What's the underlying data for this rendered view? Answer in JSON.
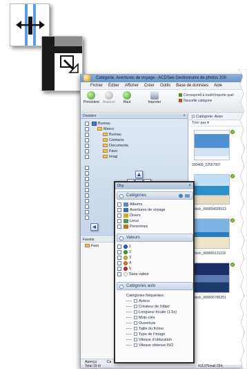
{
  "app": {
    "title": "Catégorie: Aventures de voyage - ACDSee Gestionnaire de photos 200",
    "menu": [
      "Fichier",
      "Éditer",
      "Afficher",
      "Créer",
      "Outils",
      "Base de données",
      "Aide"
    ],
    "toolbar": {
      "previous": "Précédent",
      "forward": "Avancer",
      "up": "Haut",
      "import": "Importer",
      "match_any": "Correspond à tout/n'importe quel",
      "new_category": "Nouvelle catégorie"
    },
    "folders_pane": {
      "title": "Dossiers",
      "tree": [
        "Bureau",
        "Marco",
        "Bureau",
        "Contacts",
        "Documents",
        "Favo",
        "Imag"
      ]
    },
    "preview_pane": {
      "title": "Favoris",
      "item": "Favo"
    },
    "bottom_tabs": [
      "Aperçu",
      "Ca"
    ],
    "statusbar": {
      "left": "Total 19 él",
      "right": "411375mall",
      "far_right": "254,"
    },
    "thumbnails": {
      "header": "[1 Catégorie: Aven",
      "sort": "Trier par",
      "items": [
        {
          "caption": "330408_22557997"
        },
        {
          "caption": "iStock_000004825513"
        },
        {
          "caption": "iStock_000005131118"
        },
        {
          "caption": "iStock_000006786351"
        }
      ]
    }
  },
  "organizer": {
    "title": "Org",
    "categories": {
      "header": "Catégories",
      "items": [
        "Albums",
        "Aventures de voyage",
        "Divers",
        "Lieux",
        "Personnes"
      ]
    },
    "ratings": {
      "header": "Valeurs",
      "items": [
        "1",
        "2",
        "3",
        "4",
        "5",
        "Sans valeur"
      ],
      "colors": [
        "#1d5fd0",
        "#3aa23a",
        "#e0b020",
        "#e07a1c",
        "#d02a2a",
        "#ffffff"
      ]
    },
    "auto_categories": {
      "header": "Catégories auto",
      "group": "Catégories fréquentes",
      "items": [
        "Auteur",
        "Créateur de l'objet",
        "Longueur focale (1.5x)",
        "Mots-clés",
        "Ouverture",
        "Taille du fichier",
        "Type de l'image",
        "Vitesse d'obturation",
        "Vitesse obtenue ISO"
      ]
    }
  }
}
